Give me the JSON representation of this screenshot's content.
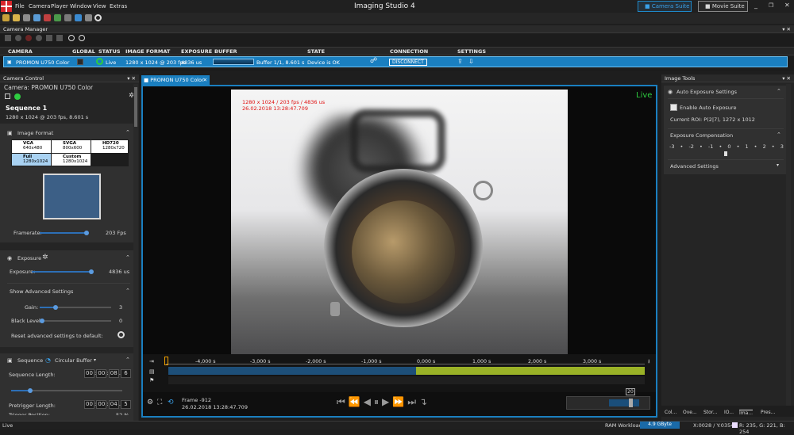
{
  "app": {
    "title": "Imaging Studio 4",
    "menu": [
      "File",
      "Camera",
      "Player",
      "Window",
      "View",
      "Extras"
    ],
    "suites": {
      "camera": "Camera Suite",
      "movie": "Movie Suite"
    }
  },
  "camera_manager": {
    "title": "Camera Manager",
    "columns": [
      "CAMERA",
      "GLOBAL",
      "STATUS",
      "IMAGE FORMAT",
      "EXPOSURE",
      "BUFFER",
      "STATE",
      "CONNECTION",
      "SETTINGS"
    ],
    "row": {
      "camera": "PROMON U750 Color",
      "status": "Live",
      "format": "1280 x 1024 @ 203 fps",
      "exposure": "4836 us",
      "buffer": "Buffer 1/1, 8.601 s",
      "state": "Device is OK",
      "connection": "DISCONNECT"
    }
  },
  "camera_control": {
    "title": "Camera Control",
    "camera_label": "Camera:",
    "camera_name": "PROMON U750 Color",
    "sequence_title": "Sequence 1",
    "sequence_info": "1280 x 1024 @ 203 fps, 8.601 s",
    "image_format": {
      "title": "Image Format",
      "options": [
        {
          "name": "VGA",
          "res": "640x480"
        },
        {
          "name": "SVGA",
          "res": "800x600"
        },
        {
          "name": "HD720",
          "res": "1280x720"
        },
        {
          "name": "Full",
          "res": "1280x1024"
        },
        {
          "name": "Custom",
          "res": "1280x1024"
        }
      ],
      "selected": "Full"
    },
    "framerate_label": "Framerate:",
    "framerate_value": "203 Fps",
    "framerate_level": 0.95,
    "exposure": {
      "title": "Exposure",
      "label": "Exposure:",
      "value": "4836 us",
      "level": 0.95,
      "show_advanced": "Show Advanced Settings",
      "gain_label": "Gain:",
      "gain_value": "3",
      "black_label": "Black Level:",
      "black_value": "0",
      "reset_label": "Reset advanced settings to default:"
    },
    "sequence": {
      "title": "Sequence",
      "mode": "Circular Buffer",
      "length_label": "Sequence Length:",
      "length": [
        "00",
        "00",
        "08",
        "6"
      ],
      "pretrigger_label": "Pretrigger Length:",
      "pretrigger": [
        "00",
        "00",
        "04",
        "5"
      ],
      "trigger_label": "Trigger Position:",
      "trigger_value": "52 %"
    }
  },
  "viewer": {
    "tab": "PROMON U750 Color",
    "overlay_line1": "1280 x 1024 / 203 fps / 4836 us",
    "overlay_line2": "26.02.2018 13:28:47.709",
    "live": "Live",
    "timeline": [
      "-4,000 s",
      "-3,000 s",
      "-2,000 s",
      "-1,000 s",
      "0,000 s",
      "1,000 s",
      "2,000 s",
      "3,000 s"
    ],
    "frame": "Frame -912",
    "frame_time": "26.02.2018 13:28:47.709",
    "speed": "20",
    "speed_level": 0.9
  },
  "image_tools": {
    "title": "Image Tools",
    "auto_exposure_title": "Auto Exposure Settings",
    "enable_label": "Enable Auto Exposure",
    "roi": "Current ROI: P(2|7), 1272 x 1012",
    "compensation_title": "Exposure Compensation",
    "scale": [
      "-3",
      "-2",
      "-1",
      "0",
      "1",
      "2",
      "3"
    ],
    "advanced": "Advanced Settings",
    "tabs": [
      "Col...",
      "Ove...",
      "Stor...",
      "IO...",
      "Ima...",
      "Pres..."
    ]
  },
  "status": {
    "left": "Live",
    "ram_label": "RAM Workload:",
    "ram_value": "4.9 GByte",
    "xy": "X:0028 / Y:0354",
    "rgb": "R: 235, G: 221, B: 254"
  },
  "colors": {
    "accent": "#1e88c8",
    "live_green": "#2ecc40",
    "status_blue": "#007acc"
  }
}
